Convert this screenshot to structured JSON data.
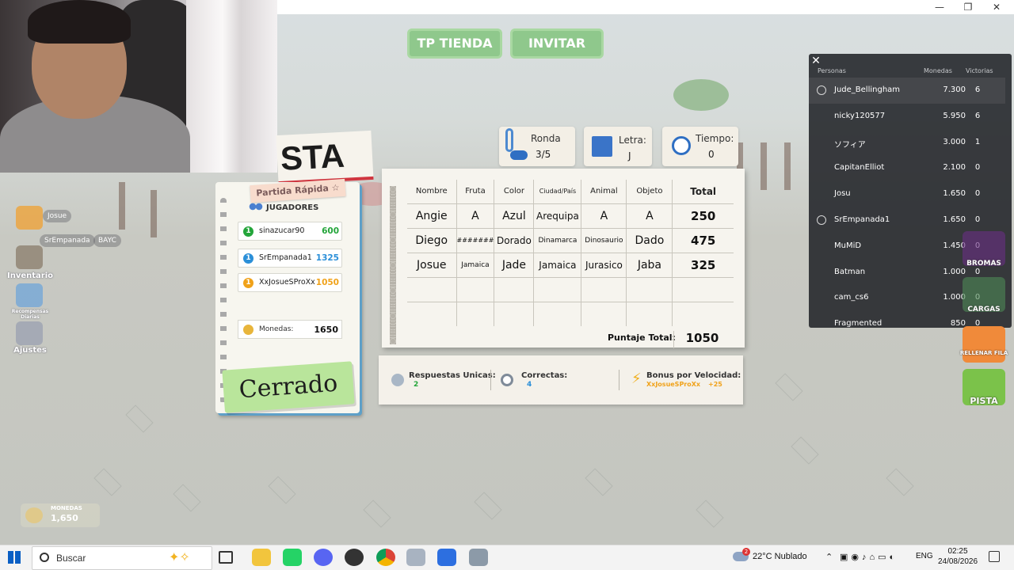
{
  "window": {
    "minimize": "—",
    "maximize": "❐",
    "close": "✕"
  },
  "top_buttons": {
    "shop": "TP TIENDA",
    "invite": "INVITAR"
  },
  "left_hud": {
    "discord_user": "Josue",
    "player_chip": "SrEmpanada",
    "clan_chip": "BAYC",
    "inventory": "Inventario",
    "rewards": "Recompensas Diarias",
    "settings": "Ajustes",
    "coins_label": "MONEDAS",
    "coins_value": "1,650"
  },
  "title_banner": "STA",
  "mode": "Partida Rápida ☆",
  "players_panel": {
    "header": "JUGADORES",
    "players": [
      {
        "name": "sinazucar90",
        "score": "600",
        "color": "#24a53a"
      },
      {
        "name": "SrEmpanada1",
        "score": "1325",
        "color": "#2b8fd8"
      },
      {
        "name": "XxJosueSProXx",
        "score": "1050",
        "color": "#f0a21a"
      }
    ],
    "coins_label": "Monedas:",
    "coins_value": "1650",
    "status": "Cerrado"
  },
  "round_info": {
    "round_label": "Ronda",
    "round_value": "3/5",
    "letter_label": "Letra:",
    "letter_value": "J",
    "time_label": "Tiempo:",
    "time_value": "0"
  },
  "score_sheet": {
    "headers": [
      "Nombre",
      "Fruta",
      "Color",
      "Ciudad/País",
      "Animal",
      "Objeto",
      "Total"
    ],
    "rows": [
      [
        "Angie",
        "A",
        "Azul",
        "Arequipa",
        "A",
        "A",
        "250"
      ],
      [
        "Diego",
        "#######",
        "Dorado",
        "Dinamarca",
        "Dinosaurio",
        "Dado",
        "475"
      ],
      [
        "Josue",
        "Jamaica",
        "Jade",
        "Jamaica",
        "Jurasico",
        "Jaba",
        "325"
      ],
      [
        "",
        "",
        "",
        "",
        "",
        "",
        ""
      ],
      [
        "",
        "",
        "",
        "",
        "",
        "",
        ""
      ]
    ],
    "total_label": "Puntaje Total:",
    "total_value": "1050"
  },
  "stats": {
    "unique_label": "Respuestas Unicas:",
    "unique_value": "2",
    "correct_label": "Correctas:",
    "correct_value": "4",
    "speed_label": "Bonus por Velocidad:",
    "speed_player": "XxJosueSProXx",
    "speed_value": "+25"
  },
  "leaderboard": {
    "headers": {
      "people": "Personas",
      "coins": "Monedas",
      "wins": "Victorias"
    },
    "rows": [
      {
        "name": "Jude_Bellingham",
        "coins": "7.300",
        "wins": "6"
      },
      {
        "name": "nicky120577",
        "coins": "5.950",
        "wins": "6"
      },
      {
        "name": "ソフィア",
        "coins": "3.000",
        "wins": "1"
      },
      {
        "name": "CapitanElliot",
        "coins": "2.100",
        "wins": "0"
      },
      {
        "name": "Josu",
        "coins": "1.650",
        "wins": "0"
      },
      {
        "name": "SrEmpanada1",
        "coins": "1.650",
        "wins": "0"
      },
      {
        "name": "MuMiD",
        "coins": "1.450",
        "wins": "0"
      },
      {
        "name": "Batman",
        "coins": "1.000",
        "wins": "0"
      },
      {
        "name": "cam_cs6",
        "coins": "1.000",
        "wins": "0"
      },
      {
        "name": "Fragmented",
        "coins": "850",
        "wins": "0"
      }
    ]
  },
  "side_buttons": {
    "pranks": "BROMAS",
    "loads": "CARGAS",
    "fill_row": "RELLENAR FILA",
    "hint": "PISTA"
  },
  "taskbar": {
    "search_placeholder": "Buscar",
    "weather": "22°C  Nublado",
    "weather_badge": "2",
    "lang": "ENG",
    "time": "02:25",
    "date": "24/08/2026"
  }
}
